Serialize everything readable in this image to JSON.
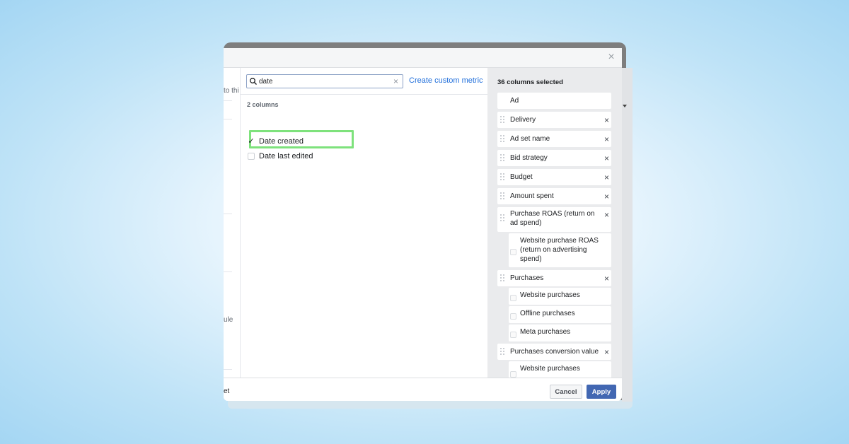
{
  "left_panel": {
    "fragments": [
      "to thi",
      "ule"
    ],
    "footer_fragment": "et"
  },
  "search": {
    "value": "date",
    "placeholder": "Search"
  },
  "create_custom_metric": "Create custom metric",
  "results": {
    "count_label": "2 columns",
    "items": [
      {
        "label": "Date created",
        "checked": true
      },
      {
        "label": "Date last edited",
        "checked": false
      }
    ]
  },
  "selected": {
    "title": "36 columns selected",
    "items": [
      {
        "label": "Ad",
        "removable": false
      },
      {
        "label": "Delivery",
        "removable": true
      },
      {
        "label": "Ad set name",
        "removable": true
      },
      {
        "label": "Bid strategy",
        "removable": true
      },
      {
        "label": "Budget",
        "removable": true
      },
      {
        "label": "Amount spent",
        "removable": true
      },
      {
        "label": "Purchase ROAS (return on ad spend)",
        "removable": true,
        "sub": [
          "Website purchase ROAS (return on advertising spend)"
        ]
      },
      {
        "label": "Purchases",
        "removable": true,
        "sub": [
          "Website purchases",
          "Offline purchases",
          "Meta purchases"
        ]
      },
      {
        "label": "Purchases conversion value",
        "removable": true,
        "sub": [
          "Website purchases"
        ]
      }
    ]
  },
  "footer": {
    "cancel": "Cancel",
    "apply": "Apply"
  },
  "colors": {
    "accent": "#4267b2",
    "link": "#216fdb",
    "highlight": "#7ee27c"
  }
}
